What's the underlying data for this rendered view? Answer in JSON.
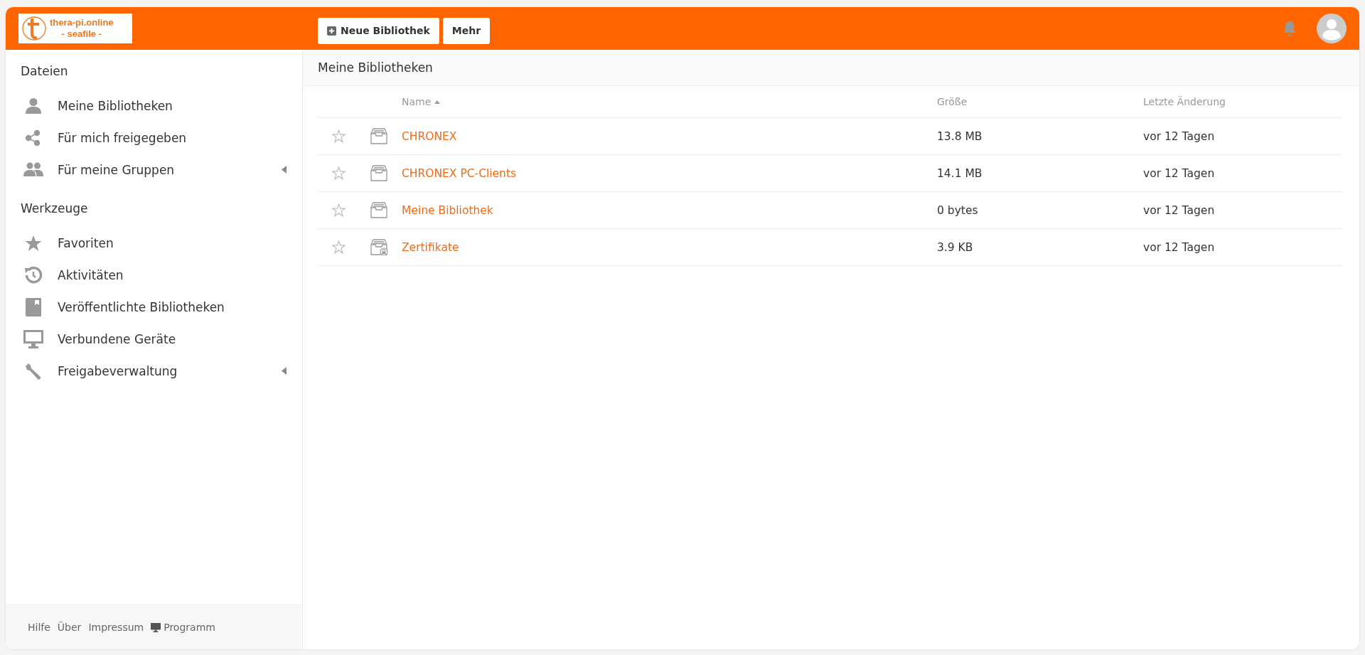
{
  "header": {
    "logo": {
      "line_1": "thera-pi.online",
      "line_2": "- seafile -"
    },
    "buttons": [
      {
        "label": "Neue Bibliothek",
        "kind": "add"
      },
      {
        "label": "Mehr",
        "kind": "plain"
      }
    ]
  },
  "sidebar": {
    "sections": [
      {
        "title": "Dateien",
        "items": [
          {
            "label": "Meine Bibliotheken",
            "kind": "person",
            "has_submenu": false
          },
          {
            "label": "Für mich freigegeben",
            "kind": "share",
            "has_submenu": false
          },
          {
            "label": "Für meine Gruppen",
            "kind": "group",
            "has_submenu": true
          }
        ]
      },
      {
        "title": "Werkzeuge",
        "items": [
          {
            "label": "Favoriten",
            "kind": "star",
            "has_submenu": false
          },
          {
            "label": "Aktivitäten",
            "kind": "history",
            "has_submenu": false
          },
          {
            "label": "Veröffentlichte Bibliotheken",
            "kind": "book",
            "has_submenu": false
          },
          {
            "label": "Verbundene Geräte",
            "kind": "monitor",
            "has_submenu": false
          },
          {
            "label": "Freigabeverwaltung",
            "kind": "wrench",
            "has_submenu": true
          }
        ]
      }
    ],
    "footer": [
      {
        "label": "Hilfe",
        "kind": "plain"
      },
      {
        "label": "Über",
        "kind": "plain"
      },
      {
        "label": "Impressum",
        "kind": "plain"
      },
      {
        "label": "Programm",
        "kind": "desktop"
      }
    ]
  },
  "main": {
    "title": "Meine Bibliotheken",
    "table": {
      "columns": [
        {
          "label": "Name",
          "sorted": true
        },
        {
          "label": "Größe",
          "sorted": false
        },
        {
          "label": "Letzte Änderung",
          "sorted": false
        }
      ],
      "rows": [
        {
          "name": "CHRONEX",
          "size": "13.8 MB",
          "modified": "vor 12 Tagen",
          "starred": false,
          "encrypted": false
        },
        {
          "name": "CHRONEX PC-Clients",
          "size": "14.1 MB",
          "modified": "vor 12 Tagen",
          "starred": false,
          "encrypted": false
        },
        {
          "name": "Meine Bibliothek",
          "size": "0 bytes",
          "modified": "vor 12 Tagen",
          "starred": false,
          "encrypted": false
        },
        {
          "name": "Zertifikate",
          "size": "3.9 KB",
          "modified": "vor 12 Tagen",
          "starred": false,
          "encrypted": true
        }
      ]
    }
  }
}
